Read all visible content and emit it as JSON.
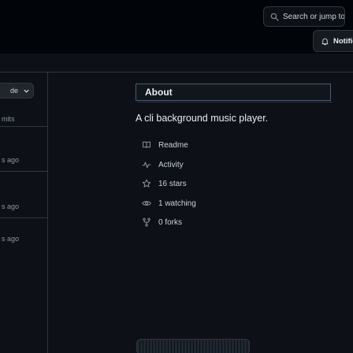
{
  "search": {
    "text": "Search or jump to..."
  },
  "notifications": {
    "label": "Notifications"
  },
  "left_sidebar": {
    "button_label": "de",
    "commits_label": "mits",
    "timestamps": [
      "s ago",
      "s ago",
      "s ago"
    ]
  },
  "about": {
    "title": "About",
    "description": "A cli background music player.",
    "links": [
      {
        "icon": "book-icon",
        "label": "Readme"
      },
      {
        "icon": "pulse-icon",
        "label": "Activity"
      },
      {
        "icon": "star-icon",
        "label": "16 stars"
      },
      {
        "icon": "eye-icon",
        "label": "1 watching"
      },
      {
        "icon": "fork-icon",
        "label": "0 forks"
      }
    ]
  },
  "colors": {
    "background": "#0d1117",
    "header": "#010409",
    "border": "#30363d",
    "text": "#c9d1d9",
    "heading": "#e6edf3"
  }
}
